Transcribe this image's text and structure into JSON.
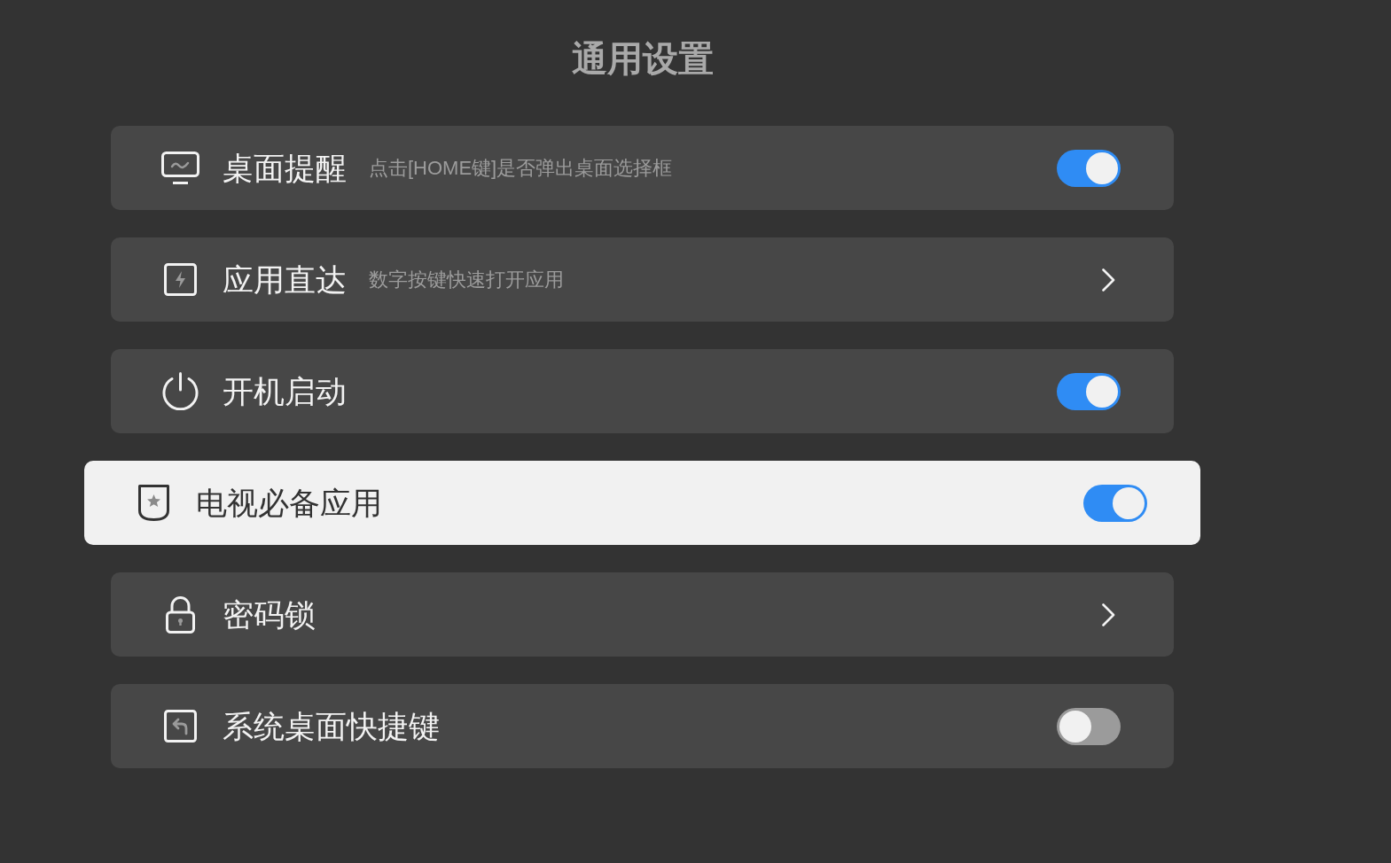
{
  "title": "通用设置",
  "items": [
    {
      "kind": "toggle",
      "label": "桌面提醒",
      "description": "点击[HOME键]是否弹出桌面选择框",
      "on": true,
      "selected": false
    },
    {
      "kind": "link",
      "label": "应用直达",
      "description": "数字按键快速打开应用",
      "selected": false
    },
    {
      "kind": "toggle",
      "label": "开机启动",
      "on": true,
      "selected": false
    },
    {
      "kind": "toggle",
      "label": "电视必备应用",
      "on": true,
      "selected": true
    },
    {
      "kind": "link",
      "label": "密码锁",
      "selected": false
    },
    {
      "kind": "toggle",
      "label": "系统桌面快捷键",
      "on": false,
      "selected": false
    }
  ]
}
